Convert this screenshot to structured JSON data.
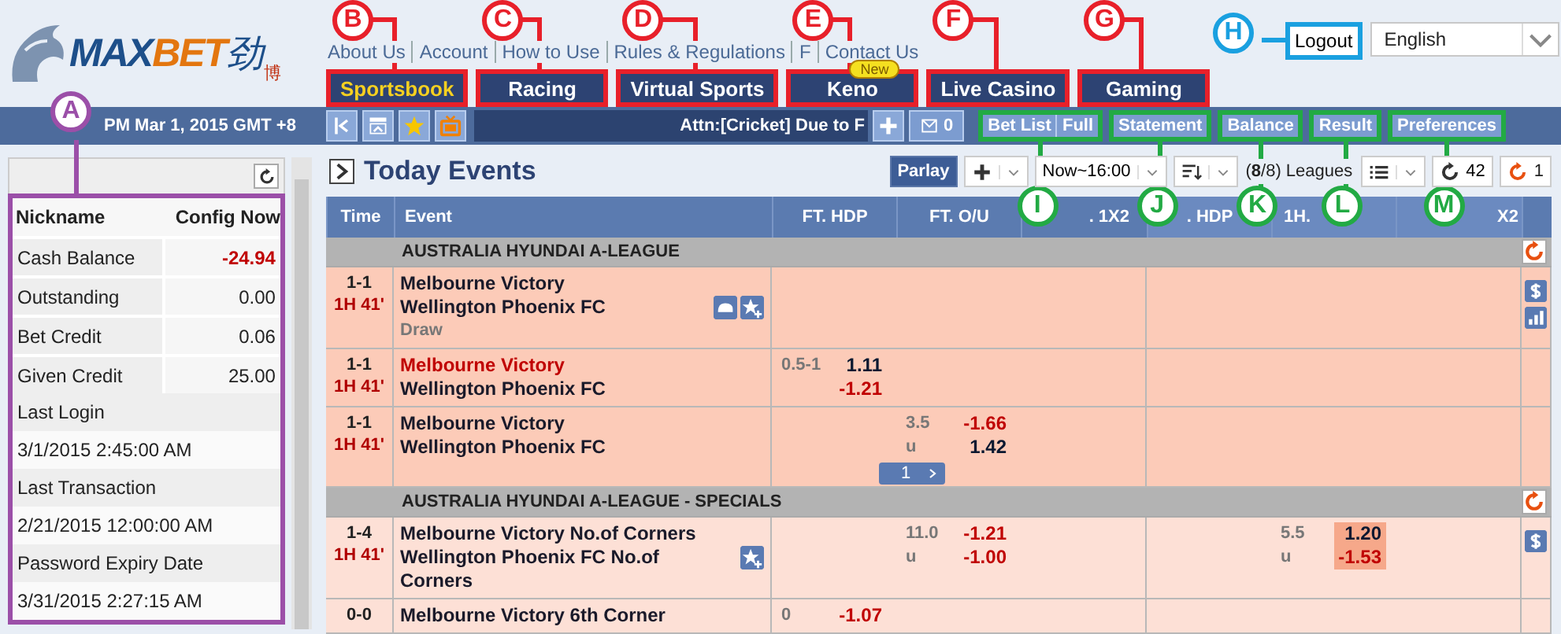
{
  "logo": {
    "parts": [
      {
        "text": "MAX",
        "color": "#1d4f8a"
      },
      {
        "text": "BET",
        "color": "#e3760f"
      }
    ],
    "mark": "劲",
    "mark_small": "博"
  },
  "top_links": [
    "About Us",
    "Account",
    "How to Use",
    "Rules & Regulations",
    "F",
    "Contact Us"
  ],
  "tabs": [
    {
      "label": "Sportsbook",
      "selected": true,
      "callout": {
        "letter": "B",
        "color": "#e8202a"
      }
    },
    {
      "label": "Racing",
      "selected": false,
      "callout": {
        "letter": "C",
        "color": "#e8202a"
      }
    },
    {
      "label": "Virtual Sports",
      "selected": false,
      "callout": {
        "letter": "D",
        "color": "#e8202a"
      }
    },
    {
      "label": "Keno",
      "selected": false,
      "badge": "New",
      "callout": {
        "letter": "E",
        "color": "#e8202a"
      }
    },
    {
      "label": "Live Casino",
      "selected": false,
      "callout": {
        "letter": "F",
        "color": "#e8202a"
      }
    },
    {
      "label": "Gaming",
      "selected": false,
      "callout": {
        "letter": "G",
        "color": "#e8202a"
      }
    }
  ],
  "logout": {
    "label": "Logout",
    "callout": {
      "letter": "H",
      "color": "#1aa0e0"
    }
  },
  "language": "English",
  "clock": "PM Mar 1, 2015 GMT +8",
  "quick_icons": [
    {
      "kind": "collapse"
    },
    {
      "kind": "top"
    },
    {
      "kind": "star"
    },
    {
      "kind": "tv"
    }
  ],
  "ticker": "Attn:[Cricket] Due to F",
  "messages": "0",
  "menu": [
    {
      "labels": [
        "Bet List",
        "Full"
      ],
      "callout": {
        "letter": "I",
        "color": "#22aa44"
      }
    },
    {
      "labels": [
        "Statement"
      ],
      "callout": {
        "letter": "J",
        "color": "#22aa44"
      }
    },
    {
      "labels": [
        "Balance"
      ],
      "callout": {
        "letter": "K",
        "color": "#22aa44"
      }
    },
    {
      "labels": [
        "Result"
      ],
      "callout": {
        "letter": "L",
        "color": "#22aa44"
      }
    },
    {
      "labels": [
        "Preferences"
      ],
      "callout": {
        "letter": "M",
        "color": "#22aa44"
      }
    }
  ],
  "account": {
    "columns": [
      "Nickname",
      "Config Now"
    ],
    "callout": {
      "letter": "A",
      "color": "#9b4fa8"
    },
    "rows": [
      {
        "kind": "pair",
        "label": "Cash Balance",
        "value": "-24.94",
        "negative": true
      },
      {
        "kind": "pair",
        "label": "Outstanding",
        "value": "0.00",
        "negative": false
      },
      {
        "kind": "pair",
        "label": "Bet Credit",
        "value": "0.06",
        "negative": false
      },
      {
        "kind": "pair",
        "label": "Given Credit",
        "value": "25.00",
        "negative": false
      },
      {
        "kind": "stacked",
        "label": "Last Login",
        "value": "3/1/2015 2:45:00 AM"
      },
      {
        "kind": "stacked",
        "label": "Last Transaction",
        "value": "2/21/2015 12:00:00 AM"
      },
      {
        "kind": "stacked",
        "label": "Password Expiry Date",
        "value": "3/31/2015 2:27:15 AM"
      }
    ]
  },
  "section": {
    "title": "Today Events",
    "controls": [
      {
        "kind": "toggle",
        "label": "Parlay",
        "on": true
      },
      {
        "kind": "add_menu"
      },
      {
        "kind": "dropdown",
        "label": "Now~16:00"
      },
      {
        "kind": "sort_menu"
      },
      {
        "kind": "text",
        "label": "(**8**/8) Leagues"
      },
      {
        "kind": "list_menu"
      },
      {
        "kind": "refresh",
        "label": "42",
        "alert": false
      },
      {
        "kind": "refresh",
        "label": "1",
        "alert": true
      }
    ]
  },
  "table": {
    "columns": [
      "Time",
      "Event",
      "FT. HDP",
      "FT. O/U",
      ". 1X2",
      ". HDP",
      "1H.",
      "X2"
    ],
    "groups": [
      {
        "league": "AUSTRALIA HYUNDAI A-LEAGUE",
        "rows": [
          {
            "score": "1-1",
            "clock": "1H 41'",
            "home": "Melbourne Victory",
            "away": "Wellington Phoenix FC",
            "home_favored": false,
            "draw": "Draw",
            "icons": [
              {
                "kind": "live"
              },
              {
                "kind": "favorite"
              }
            ],
            "side_icons": [
              {
                "kind": "dollar"
              },
              {
                "kind": "chart"
              }
            ]
          },
          {
            "score": "1-1",
            "clock": "1H 41'",
            "home": "Melbourne Victory",
            "away": "Wellington Phoenix FC",
            "home_favored": true,
            "ft_hdp": {
              "lines": [
                "0.5-1"
              ],
              "highlighted": false,
              "odds": [
                {
                  "value": "1.11",
                  "negative": false
                },
                {
                  "value": "-1.21",
                  "negative": true
                }
              ]
            }
          },
          {
            "score": "1-1",
            "clock": "1H 41'",
            "home": "Melbourne Victory",
            "away": "Wellington Phoenix FC",
            "home_favored": false,
            "pager": "1",
            "ft_ou": {
              "lines": [
                "3.5",
                "u"
              ],
              "highlighted": false,
              "odds": [
                {
                  "value": "-1.66",
                  "negative": true
                },
                {
                  "value": "1.42",
                  "negative": false
                }
              ]
            }
          }
        ]
      },
      {
        "league": "AUSTRALIA HYUNDAI A-LEAGUE - SPECIALS",
        "rows": [
          {
            "score": "1-4",
            "clock": "1H 41'",
            "home": "Melbourne Victory No.of Corners",
            "away": "Wellington Phoenix FC No.of Corners",
            "home_favored": false,
            "icons": [
              {
                "kind": "favorite"
              }
            ],
            "side_icons": [
              {
                "kind": "dollar"
              }
            ],
            "ft_ou": {
              "lines": [
                "11.0",
                "u"
              ],
              "highlighted": false,
              "odds": [
                {
                  "value": "-1.21",
                  "negative": true
                },
                {
                  "value": "-1.00",
                  "negative": true
                }
              ]
            },
            "h1_ou": {
              "lines": [
                "5.5",
                "u"
              ],
              "highlighted": true,
              "odds": [
                {
                  "value": "1.20",
                  "negative": false
                },
                {
                  "value": "-1.53",
                  "negative": true
                }
              ]
            }
          },
          {
            "score": "0-0",
            "home": "Melbourne Victory 6th Corner",
            "home_favored": false,
            "ft_hdp": {
              "lines": [
                "0"
              ],
              "highlighted": false,
              "odds": [
                {
                  "value": "-1.07",
                  "negative": true
                }
              ]
            }
          }
        ]
      }
    ]
  }
}
